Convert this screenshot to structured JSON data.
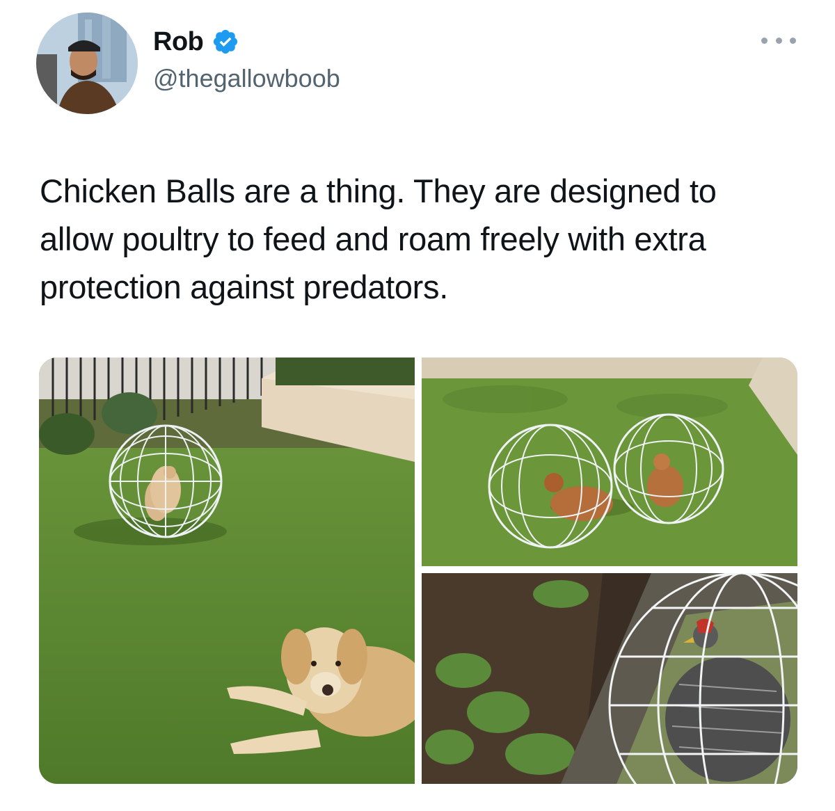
{
  "author": {
    "display_name": "Rob",
    "handle": "@thegallowboob",
    "verified": true,
    "verified_color": "#1d9bf0"
  },
  "tweet": {
    "text": "Chicken Balls are a thing. They are designed to allow poultry to feed and roam freely with extra protection against predators."
  },
  "icons": {
    "verified": "verified-badge-icon",
    "more": "more-options-icon"
  },
  "media": {
    "count": 3
  },
  "colors": {
    "text": "#0f1419",
    "secondary_text": "#536471",
    "grass": "#6e9a3c"
  }
}
